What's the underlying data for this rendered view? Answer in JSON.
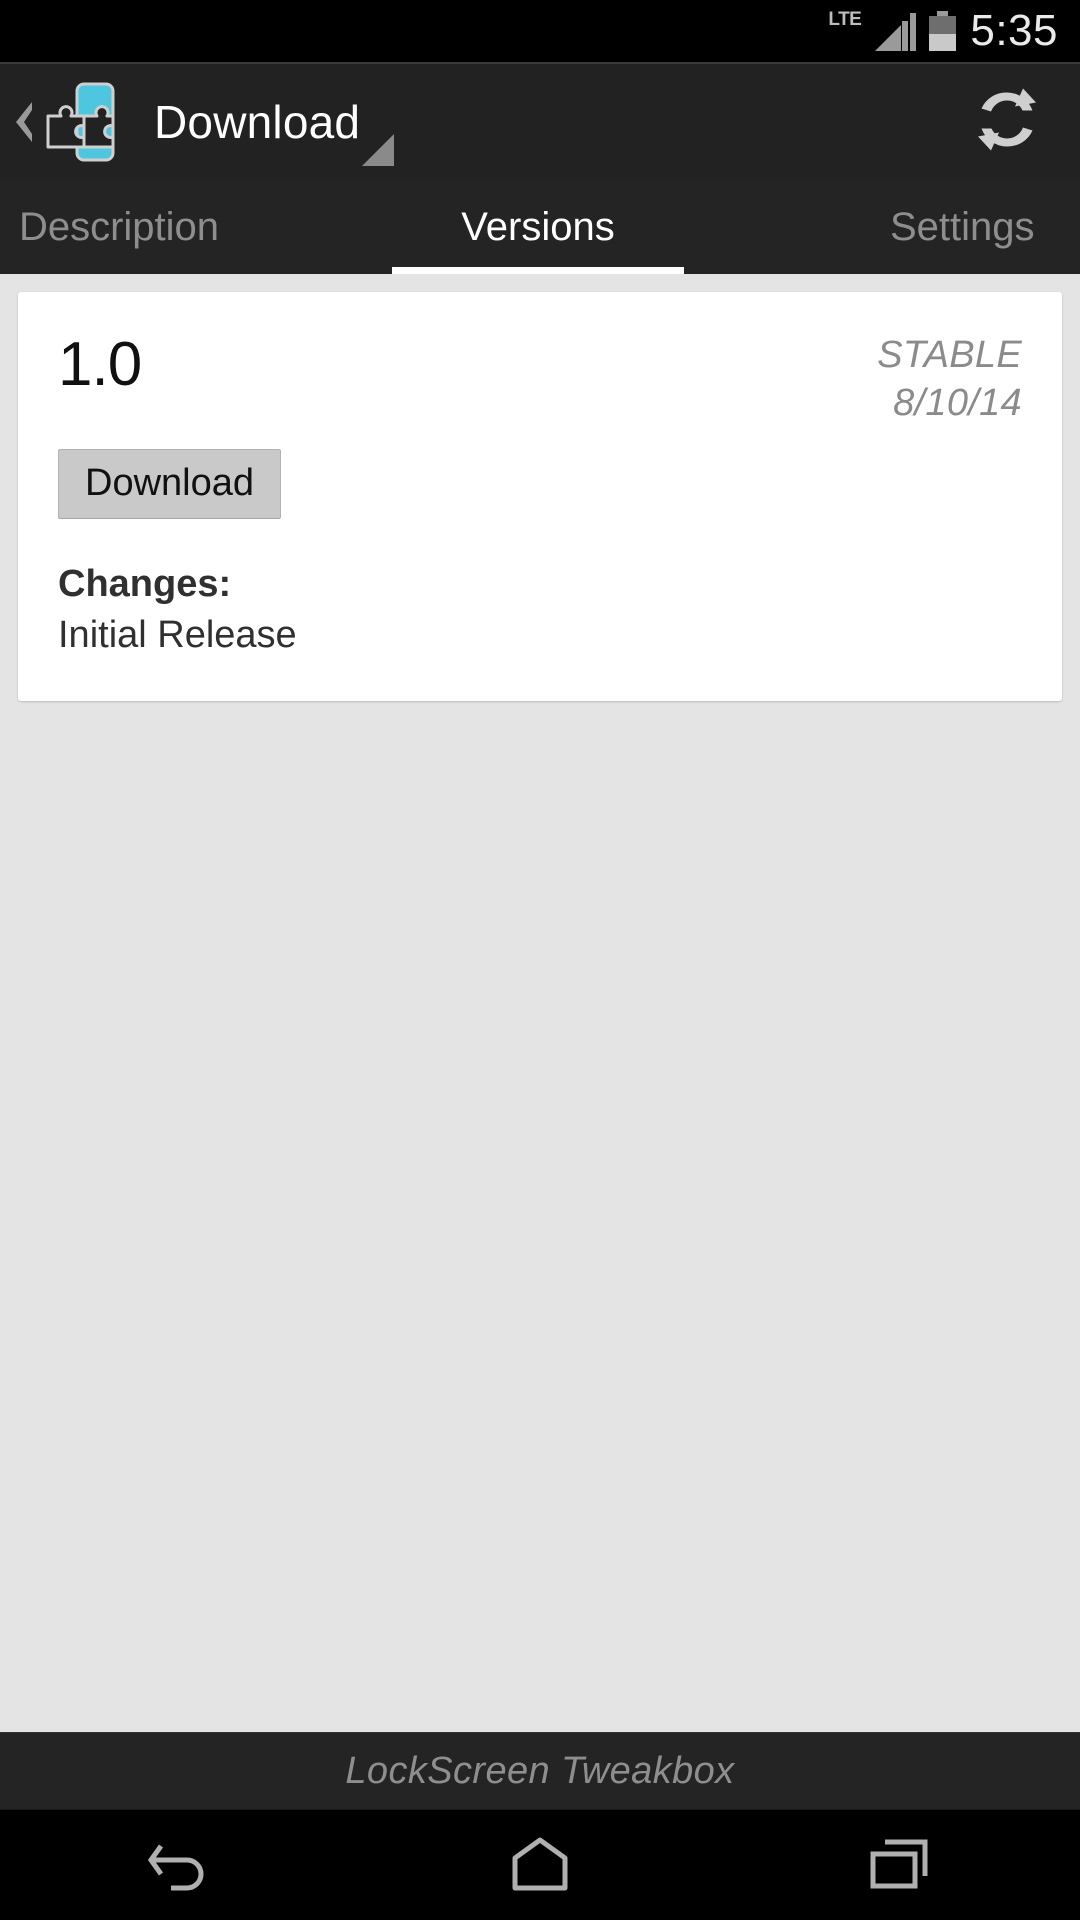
{
  "status_bar": {
    "network_label": "LTE",
    "time": "5:35",
    "signal_icon": "signal-bars-icon",
    "battery_icon": "battery-icon"
  },
  "action_bar": {
    "app_icon": "xposed-puzzle-icon",
    "up_icon": "back-chevron-icon",
    "title": "Download",
    "dropdown_icon": "dropdown-caret-icon",
    "refresh_icon": "refresh-icon",
    "accent_color": "#4ec6df",
    "background_color": "#222222"
  },
  "tabs": {
    "items": [
      {
        "label": "Description",
        "selected": false
      },
      {
        "label": "Versions",
        "selected": true
      },
      {
        "label": "Settings",
        "selected": false
      }
    ],
    "indicator_color": "#ffffff"
  },
  "content": {
    "versions": [
      {
        "version": "1.0",
        "channel": "STABLE",
        "date": "8/10/14",
        "download_label": "Download",
        "changes_label": "Changes:",
        "changes_text": "Initial Release"
      }
    ]
  },
  "footer": {
    "module_name": "LockScreen Tweakbox"
  },
  "navigation_bar": {
    "back_icon": "back-arrow-icon",
    "home_icon": "home-icon",
    "recents_icon": "recents-icon"
  }
}
